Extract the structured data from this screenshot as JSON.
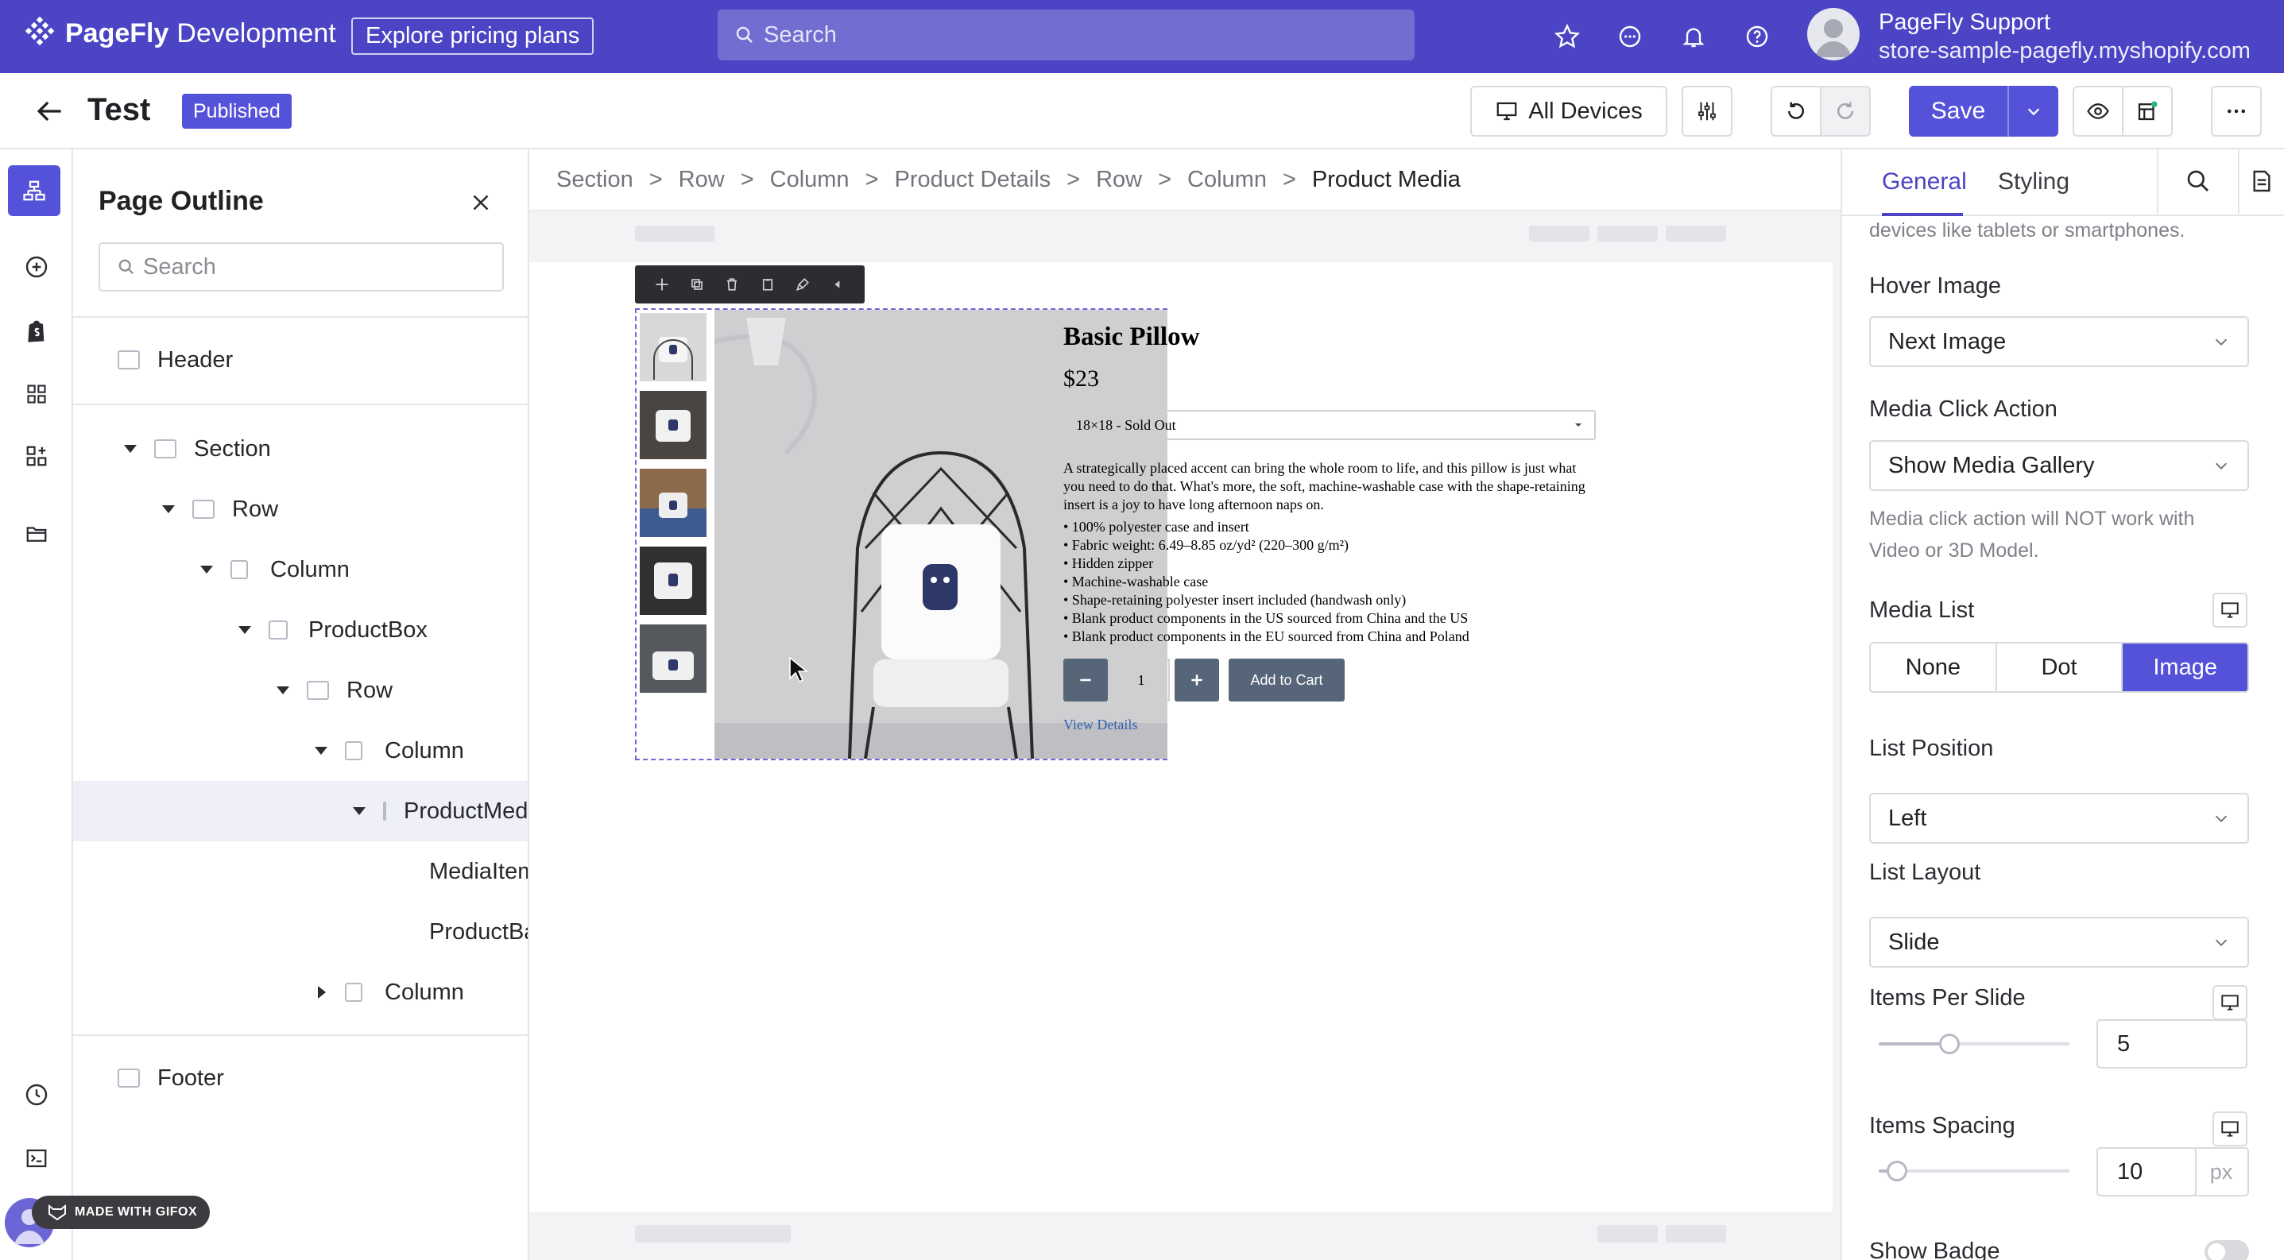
{
  "topbar": {
    "brand": "PageFly",
    "brand_suffix": "Development",
    "explore_label": "Explore pricing plans",
    "search_placeholder": "Search",
    "user_name": "PageFly Support",
    "store_url": "store-sample-pagefly.myshopify.com"
  },
  "editor": {
    "page_title": "Test",
    "status_badge": "Published",
    "devices_label": "All Devices",
    "save_label": "Save"
  },
  "outline": {
    "title": "Page Outline",
    "search_placeholder": "Search",
    "nodes": [
      {
        "label": "Header"
      },
      {
        "label": "Section"
      },
      {
        "label": "Row"
      },
      {
        "label": "Column"
      },
      {
        "label": "ProductBox"
      },
      {
        "label": "Row"
      },
      {
        "label": "Column"
      },
      {
        "label": "ProductMedia"
      },
      {
        "label": "MediaItem"
      },
      {
        "label": "ProductBadge"
      },
      {
        "label": "Column"
      },
      {
        "label": "Footer"
      }
    ]
  },
  "breadcrumbs": [
    "Section",
    "Row",
    "Column",
    "Product Details",
    "Row",
    "Column",
    "Product Media"
  ],
  "product": {
    "title": "Basic Pillow",
    "price": "$23",
    "variant": "18×18 - Sold Out",
    "description": "A strategically placed accent can bring the whole room to life, and this pillow is just what you need to do that. What's more, the soft, machine-washable case with the shape-retaining insert is a joy to have long afternoon naps on.",
    "bullets": [
      "• 100% polyester case and insert",
      "• Fabric weight: 6.49–8.85 oz/yd² (220–300 g/m²)",
      "• Hidden zipper",
      "• Machine-washable case",
      "• Shape-retaining polyester insert included (handwash only)",
      "• Blank product components in the US sourced from China and the US",
      "• Blank product components in the EU sourced from China and Poland"
    ],
    "quantity": "1",
    "add_to_cart": "Add to Cart",
    "view_details": "View Details"
  },
  "panel": {
    "tab_general": "General",
    "tab_styling": "Styling",
    "top_note": "devices like tablets or smartphones.",
    "hover_image_label": "Hover Image",
    "hover_image_value": "Next Image",
    "click_action_label": "Media Click Action",
    "click_action_value": "Show Media Gallery",
    "click_action_help": "Media click action will NOT work with Video or 3D Model.",
    "media_list_label": "Media List",
    "media_list_options": [
      "None",
      "Dot",
      "Image"
    ],
    "list_position_label": "List Position",
    "list_position_value": "Left",
    "list_layout_label": "List Layout",
    "list_layout_value": "Slide",
    "items_per_slide_label": "Items Per Slide",
    "items_per_slide_value": "5",
    "items_spacing_label": "Items Spacing",
    "items_spacing_value": "10",
    "items_spacing_unit": "px",
    "show_badge_label": "Show Badge"
  },
  "gifox": "MADE WITH GIFOX",
  "colors": {
    "brand": "#4b44c4",
    "accent": "#5452d9"
  }
}
